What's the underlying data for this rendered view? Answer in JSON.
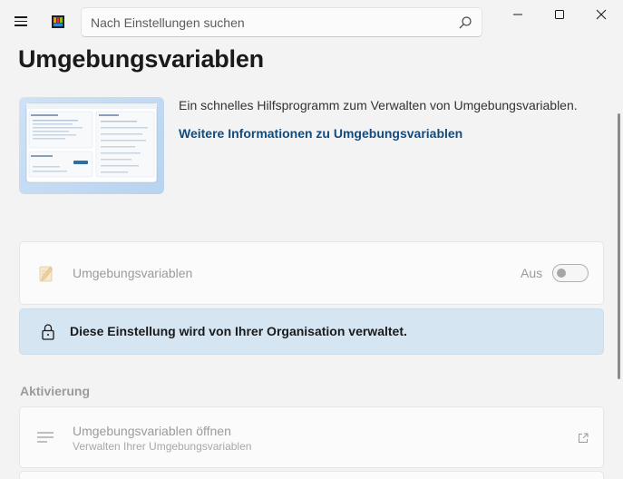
{
  "window": {
    "controls": [
      "minimize",
      "maximize",
      "close"
    ]
  },
  "search": {
    "placeholder": "Nach Einstellungen suchen",
    "value": ""
  },
  "page": {
    "title": "Umgebungsvariablen"
  },
  "hero": {
    "description": "Ein schnelles Hilfsprogramm zum Verwalten von Umgebungsvariablen.",
    "link_label": "Weitere Informationen zu Umgebungsvariablen"
  },
  "enable_card": {
    "label": "Umgebungsvariablen",
    "state_label": "Aus",
    "enabled": false
  },
  "policy_info": {
    "message": "Diese Einstellung wird von Ihrer Organisation verwaltet."
  },
  "activation": {
    "section_title": "Aktivierung",
    "open_card": {
      "title": "Umgebungsvariablen öffnen",
      "subtitle": "Verwalten Ihrer Umgebungsvariablen"
    }
  },
  "colors": {
    "accent": "#0f4c81",
    "info_background": "#d6e5f2",
    "page_background": "#f3f3f3"
  },
  "icons": {
    "menu": "hamburger-icon",
    "app": "powertoys-logo-icon",
    "search": "search-icon",
    "feature": "env-variables-icon",
    "lock": "lock-icon",
    "list": "list-icon",
    "external": "open-external-icon"
  }
}
